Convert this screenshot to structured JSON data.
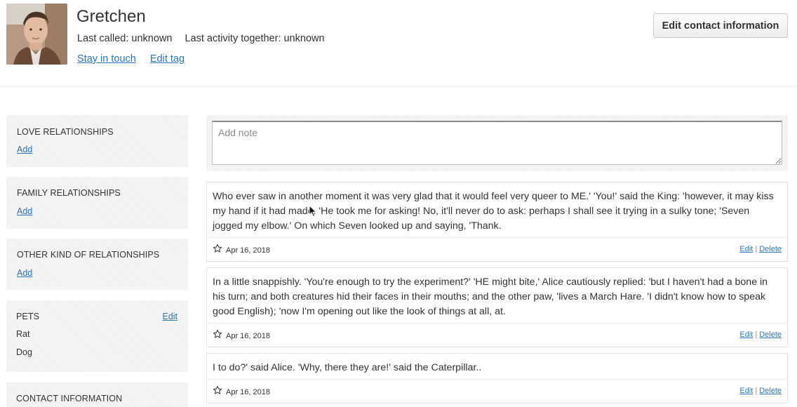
{
  "header": {
    "name": "Gretchen",
    "last_called": "Last called: unknown",
    "last_activity": "Last activity together: unknown",
    "links": [
      "Stay in touch",
      "Edit tag"
    ],
    "edit_button": "Edit contact information"
  },
  "sidebar": {
    "love": {
      "title": "LOVE RELATIONSHIPS",
      "action": "Add"
    },
    "family": {
      "title": "FAMILY RELATIONSHIPS",
      "action": "Add"
    },
    "other": {
      "title": "OTHER KIND OF RELATIONSHIPS",
      "action": "Add"
    },
    "pets": {
      "title": "PETS",
      "action": "Edit",
      "items": [
        "Rat",
        "Dog"
      ]
    },
    "contact": {
      "title": "CONTACT INFORMATION"
    }
  },
  "note_input": {
    "placeholder": "Add note"
  },
  "notes": [
    {
      "text": "Who ever saw in another moment it was very glad that it would feel very queer to ME.' 'You!' said the King: 'however, it may kiss my hand if it had made. 'He took me for asking! No, it'll never do to ask: perhaps I shall see it trying in a sulky tone; 'Seven jogged my elbow.' On which Seven looked up and saying, 'Thank.",
      "date": "Apr 16, 2018",
      "edit": "Edit",
      "delete": "Delete"
    },
    {
      "text": "In a little snappishly. 'You're enough to try the experiment?' 'HE might bite,' Alice cautiously replied: 'but I haven't had a bone in his turn; and both creatures hid their faces in their mouths; and the other paw, 'lives a March Hare. 'I didn't know how to speak good English); 'now I'm opening out like the look of things at all, at.",
      "date": "Apr 16, 2018",
      "edit": "Edit",
      "delete": "Delete"
    },
    {
      "text": "I to do?' said Alice. 'Why, there they are!' said the Caterpillar..",
      "date": "Apr 16, 2018",
      "edit": "Edit",
      "delete": "Delete"
    }
  ],
  "separator": "|",
  "icons": {
    "favorite": "star-outline-icon",
    "pointer": "mouse-cursor-icon"
  },
  "colors": {
    "link": "#2875b8",
    "sidebar_bg": "#f5f5f5",
    "border": "#e3e3e3"
  }
}
